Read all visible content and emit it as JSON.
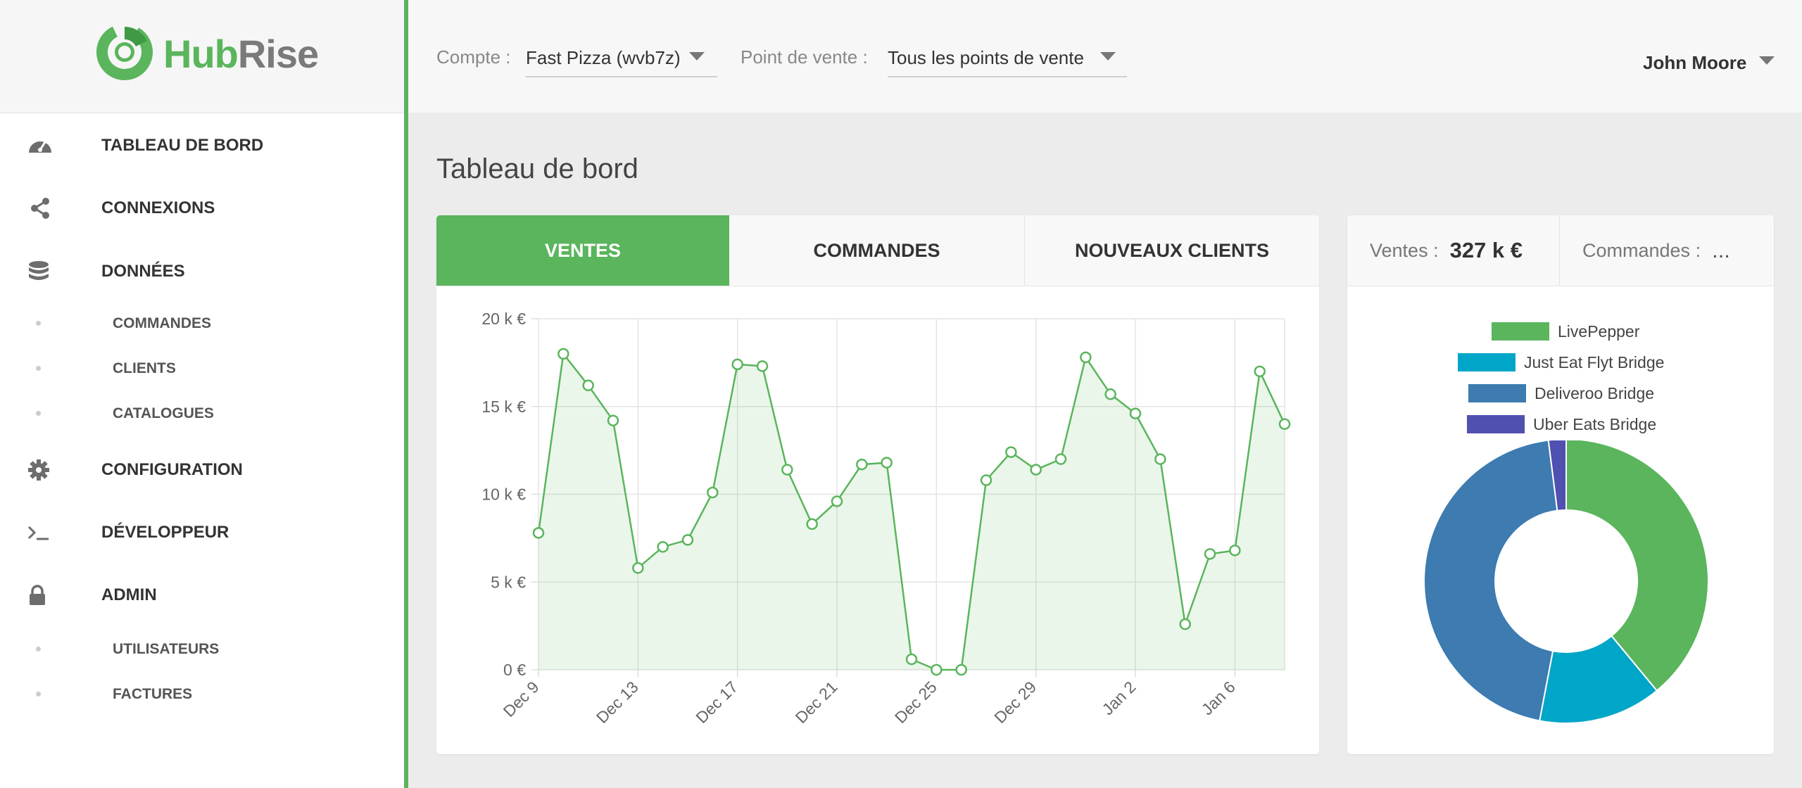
{
  "brand": {
    "hub": "Hub",
    "rise": "Rise"
  },
  "sidebar": {
    "items": [
      {
        "label": "TABLEAU DE BORD",
        "icon": "gauge-icon"
      },
      {
        "label": "CONNEXIONS",
        "icon": "share-icon"
      },
      {
        "label": "DONNÉES",
        "icon": "database-icon"
      },
      {
        "label": "CONFIGURATION",
        "icon": "gear-icon"
      },
      {
        "label": "DÉVELOPPEUR",
        "icon": "terminal-icon"
      },
      {
        "label": "ADMIN",
        "icon": "lock-icon"
      }
    ],
    "data_sub": [
      "COMMANDES",
      "CLIENTS",
      "CATALOGUES"
    ],
    "admin_sub": [
      "UTILISATEURS",
      "FACTURES"
    ]
  },
  "header": {
    "account_label": "Compte :",
    "account_value": "Fast Pizza (wvb7z)",
    "location_label": "Point de vente :",
    "location_value": "Tous les points de vente",
    "user": "John Moore"
  },
  "page": {
    "title": "Tableau de bord"
  },
  "tabs": [
    "VENTES",
    "COMMANDES",
    "NOUVEAUX CLIENTS"
  ],
  "stats": {
    "sales_label": "Ventes :",
    "sales_value": "327 k €",
    "orders_label": "Commandes :",
    "orders_value": "..."
  },
  "colors": {
    "accent": "#5ab55c",
    "livepepper": "#5ab55c",
    "justeat": "#00a6c7",
    "deliveroo": "#3d7bb0",
    "ubereats": "#5050b0"
  },
  "chart_data": [
    {
      "type": "area",
      "x": [
        "Dec 9",
        "Dec 10",
        "Dec 11",
        "Dec 12",
        "Dec 13",
        "Dec 14",
        "Dec 15",
        "Dec 16",
        "Dec 17",
        "Dec 18",
        "Dec 19",
        "Dec 20",
        "Dec 21",
        "Dec 22",
        "Dec 23",
        "Dec 24",
        "Dec 25",
        "Dec 26",
        "Dec 27",
        "Dec 28",
        "Dec 29",
        "Dec 30",
        "Dec 31",
        "Jan 1",
        "Jan 2",
        "Jan 3",
        "Jan 4",
        "Jan 5",
        "Jan 6",
        "Jan 7",
        "Jan 8"
      ],
      "values": [
        7.8,
        18.0,
        16.2,
        14.2,
        5.8,
        7.0,
        7.4,
        10.1,
        17.4,
        17.3,
        11.4,
        8.3,
        9.6,
        11.7,
        11.8,
        0.6,
        0,
        0,
        10.8,
        12.4,
        11.4,
        12.0,
        17.8,
        15.7,
        14.6,
        12.0,
        2.6,
        6.6,
        6.8,
        17.0,
        14.0
      ],
      "xticks": [
        "Dec 9",
        "Dec 13",
        "Dec 17",
        "Dec 21",
        "Dec 25",
        "Dec 29",
        "Jan 2",
        "Jan 6"
      ],
      "yticks": [
        "0 €",
        "5 k €",
        "10 k €",
        "15 k €",
        "20 k €"
      ],
      "ylim": [
        0,
        20
      ],
      "grid": true
    },
    {
      "type": "pie",
      "labels": [
        "LivePepper",
        "Just Eat Flyt Bridge",
        "Deliveroo Bridge",
        "Uber Eats Bridge"
      ],
      "values": [
        39,
        14,
        45,
        2
      ]
    }
  ]
}
